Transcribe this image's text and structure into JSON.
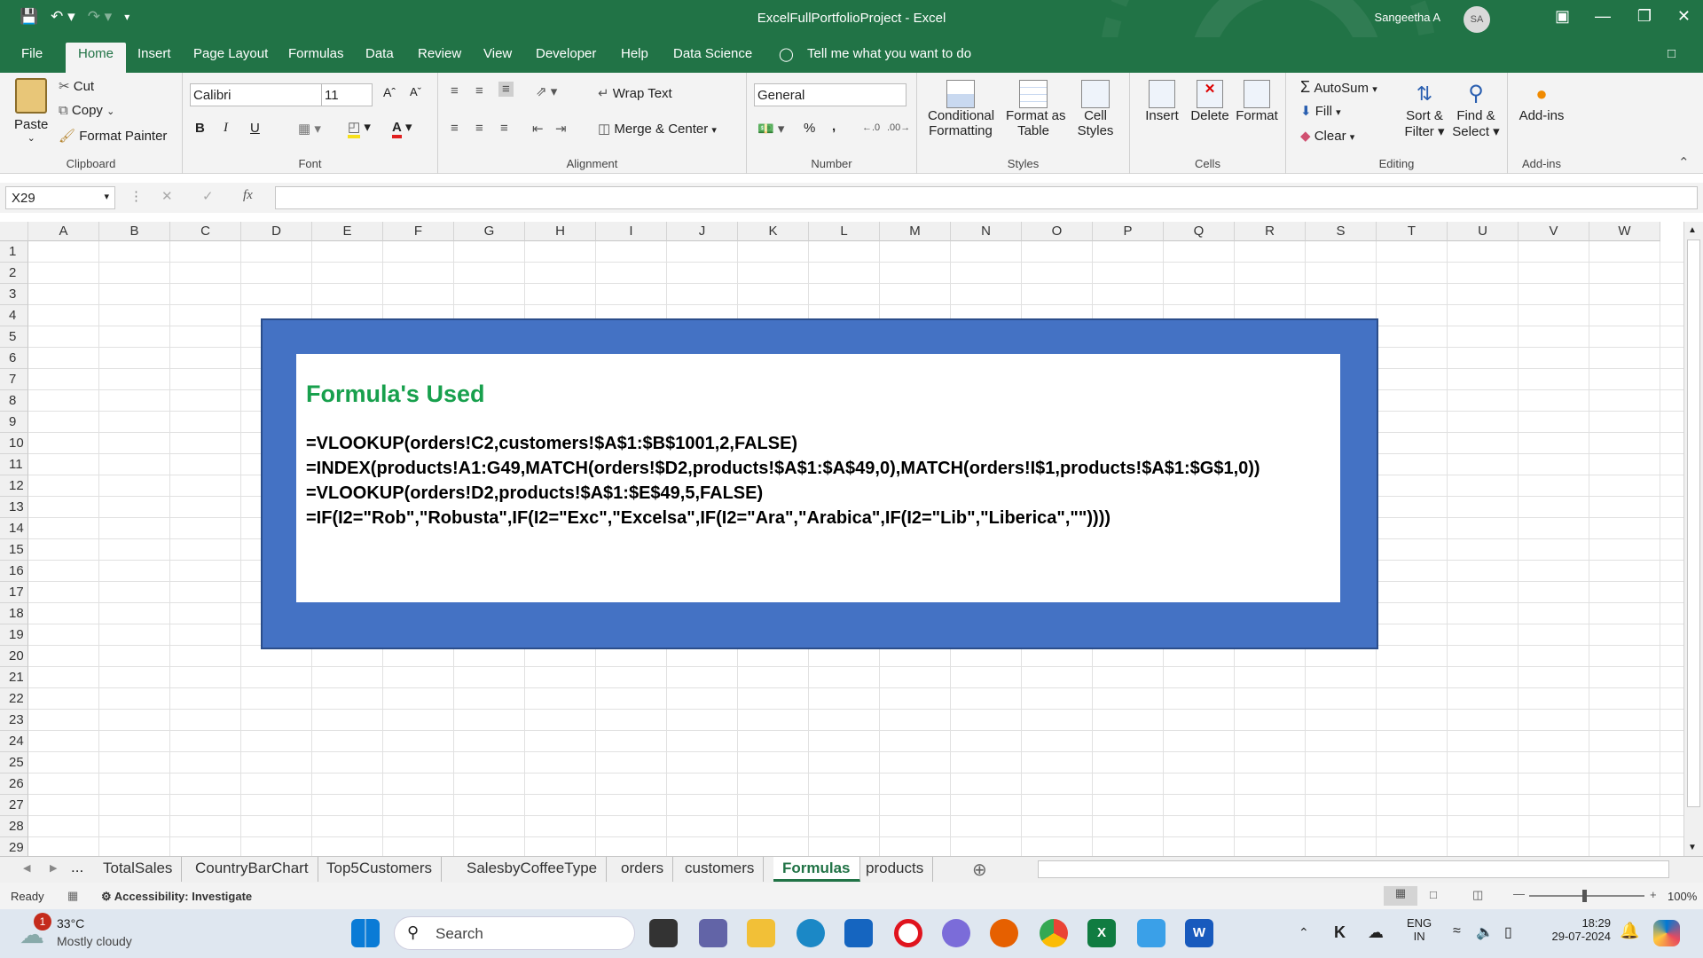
{
  "titlebar": {
    "title": "ExcelFullPortfolioProject  -  Excel",
    "user": "Sangeetha A",
    "avatar_initials": "SA"
  },
  "menu": {
    "tabs": [
      "File",
      "Home",
      "Insert",
      "Page Layout",
      "Formulas",
      "Data",
      "Review",
      "View",
      "Developer",
      "Help",
      "Data Science"
    ],
    "active": "Home",
    "tell_me": "Tell me what you want to do"
  },
  "ribbon": {
    "clipboard": {
      "paste": "Paste",
      "cut": "Cut",
      "copy": "Copy",
      "format_painter": "Format Painter",
      "label": "Clipboard"
    },
    "font": {
      "name": "Calibri",
      "size": "11",
      "label": "Font",
      "bold": "B",
      "italic": "I",
      "underline": "U"
    },
    "alignment": {
      "wrap": "Wrap Text",
      "merge": "Merge & Center",
      "label": "Alignment"
    },
    "number": {
      "format": "General",
      "label": "Number",
      "percent": "%",
      "comma": ","
    },
    "styles": {
      "conditional": "Conditional",
      "conditional2": "Formatting",
      "format_table": "Format as",
      "format_table2": "Table",
      "cell_styles": "Cell",
      "cell_styles2": "Styles",
      "label": "Styles"
    },
    "cells": {
      "insert": "Insert",
      "delete": "Delete",
      "format": "Format",
      "label": "Cells"
    },
    "editing": {
      "autosum": "AutoSum",
      "fill": "Fill",
      "clear": "Clear",
      "sort": "Sort &",
      "sort2": "Filter",
      "find": "Find &",
      "find2": "Select",
      "label": "Editing"
    },
    "addins": {
      "addins": "Add-ins",
      "label": "Add-ins"
    }
  },
  "formula_bar": {
    "name_box": "X29",
    "fx": "fx",
    "content": ""
  },
  "grid": {
    "columns": [
      "A",
      "B",
      "C",
      "D",
      "E",
      "F",
      "G",
      "H",
      "I",
      "J",
      "K",
      "L",
      "M",
      "N",
      "O",
      "P",
      "Q",
      "R",
      "S",
      "T",
      "U",
      "V",
      "W"
    ],
    "rows": [
      "1",
      "2",
      "3",
      "4",
      "5",
      "6",
      "7",
      "8",
      "9",
      "10",
      "11",
      "12",
      "13",
      "14",
      "15",
      "16",
      "17",
      "18",
      "19",
      "20",
      "21",
      "22",
      "23",
      "24",
      "25",
      "26",
      "27",
      "28",
      "29"
    ]
  },
  "panel": {
    "title": "Formula's Used",
    "formulas": [
      "=VLOOKUP(orders!C2,customers!$A$1:$B$1001,2,FALSE)",
      "=INDEX(products!A1:G49,MATCH(orders!$D2,products!$A$1:$A$49,0),MATCH(orders!I$1,products!$A$1:$G$1,0))",
      "=VLOOKUP(orders!D2,products!$A$1:$E$49,5,FALSE)",
      "=IF(I2=\"Rob\",\"Robusta\",IF(I2=\"Exc\",\"Excelsa\",IF(I2=\"Ara\",\"Arabica\",IF(I2=\"Lib\",\"Liberica\",\"\"))))"
    ]
  },
  "sheets": {
    "ellipsis": "...",
    "tabs": [
      "TotalSales",
      "CountryBarChart",
      "Top5Customers",
      "SalesbyCoffeeType",
      "orders",
      "customers",
      "Formulas",
      "products"
    ],
    "active": "Formulas"
  },
  "status": {
    "ready": "Ready",
    "accessibility": "Accessibility: Investigate",
    "zoom": "100%"
  },
  "taskbar": {
    "weather_temp": "33°C",
    "weather_desc": "Mostly cloudy",
    "weather_badge": "1",
    "search": "Search",
    "lang1": "ENG",
    "lang2": "IN",
    "time": "18:29",
    "date": "29-07-2024"
  },
  "colors": {
    "excel_green": "#217346",
    "panel_blue": "#4472c4",
    "title_green": "#18a04d"
  }
}
